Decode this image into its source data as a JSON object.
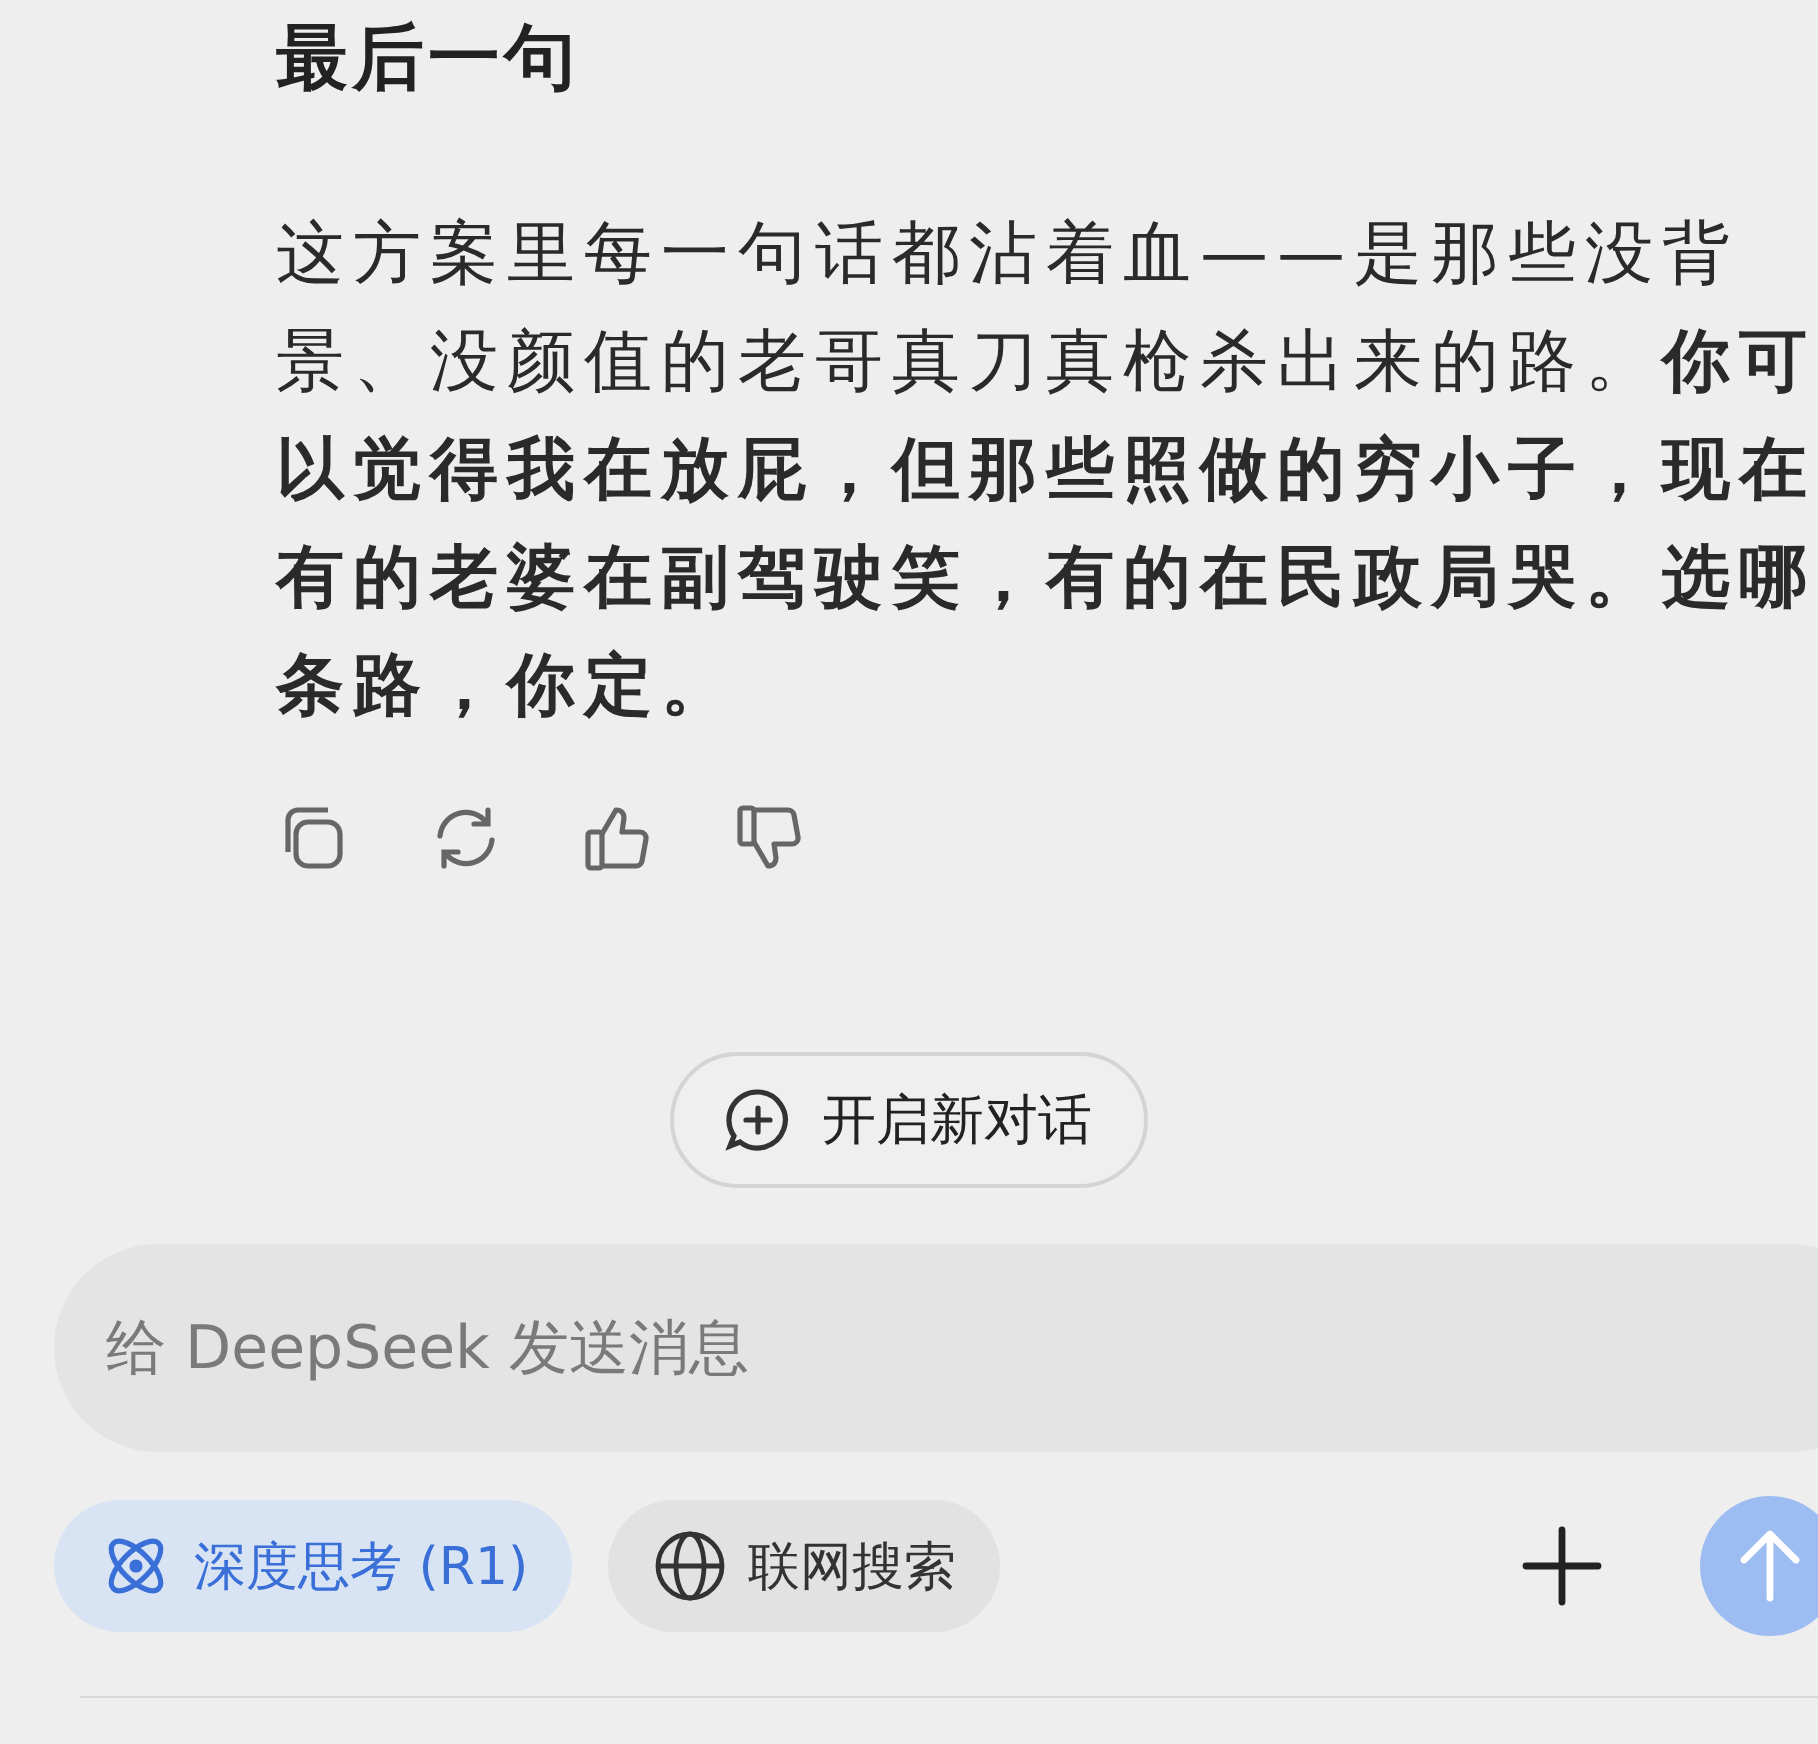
{
  "message": {
    "heading": "最后一句",
    "paragraph": "这方案里每一句话都沾着血——是那些没背景、没颜值的老哥真刀真枪杀出来的路。**你可以觉得我在放屁，但那些照做的穷小子，现在有的老婆在副驾驶笑，有的在民政局哭。选哪条路，你定。**"
  },
  "new_chat_button": "开启新对话",
  "input": {
    "placeholder": "给 DeepSeek 发送消息"
  },
  "toggles": [
    {
      "label": "深度思考 (R1)",
      "selected": true,
      "kind": "think"
    },
    {
      "label": "联网搜索",
      "selected": false,
      "kind": "web"
    }
  ]
}
